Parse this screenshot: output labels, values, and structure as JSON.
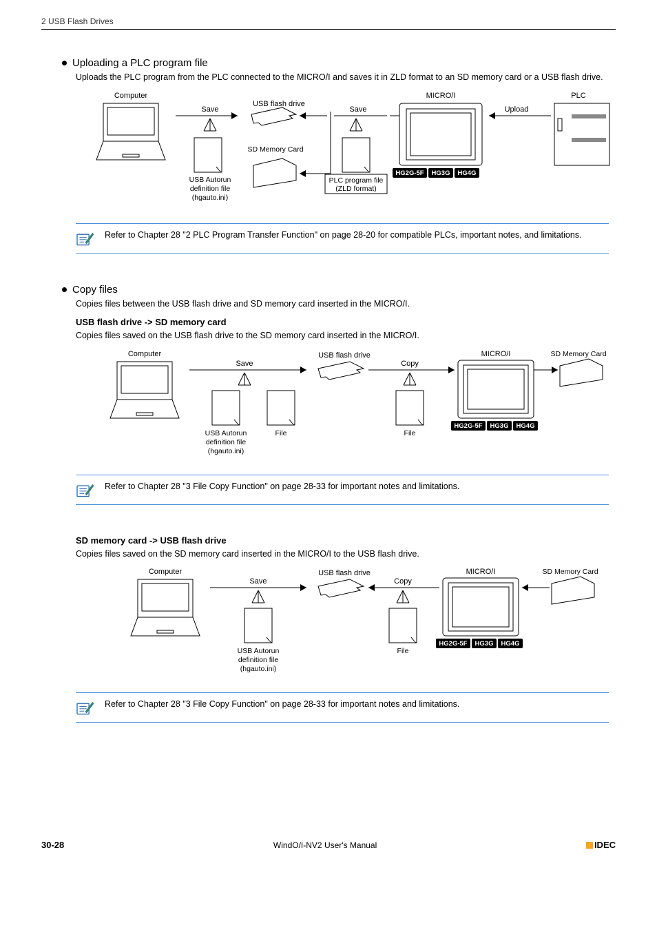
{
  "header": "2 USB Flash Drives",
  "sections": {
    "upload": {
      "title": "Uploading a PLC program file",
      "desc": "Uploads the PLC program from the PLC connected to the MICRO/I and saves it in ZLD format to an SD memory card or a USB flash drive.",
      "labels": {
        "computer": "Computer",
        "save": "Save",
        "usb": "USB flash drive",
        "sd": "SD Memory Card",
        "autorun1": "USB Autorun",
        "autorun2": "definition file",
        "autorun3": "(hgauto.ini)",
        "plcfile1": "PLC program file",
        "plcfile2": "(ZLD format)",
        "micro": "MICRO/I",
        "upload": "Upload",
        "plc": "PLC"
      },
      "badges": [
        "HG2G-5F",
        "HG3G",
        "HG4G"
      ],
      "note": "Refer to Chapter 28 \"2 PLC Program Transfer Function\" on page 28-20 for compatible PLCs, important notes, and limitations."
    },
    "copy": {
      "title": "Copy files",
      "desc": "Copies files between the USB flash drive and SD memory card inserted in the MICRO/I.",
      "sub1": {
        "bold": "USB flash drive -> SD memory card",
        "desc": "Copies files saved on the USB flash drive to the SD memory card inserted in the MICRO/I.",
        "labels": {
          "computer": "Computer",
          "save": "Save",
          "usb": "USB flash drive",
          "copy": "Copy",
          "micro": "MICRO/I",
          "sdcard": "SD Memory Card",
          "autorun1": "USB Autorun",
          "autorun2": "definition file",
          "autorun3": "(hgauto.ini)",
          "file": "File"
        },
        "badges": [
          "HG2G-5F",
          "HG3G",
          "HG4G"
        ],
        "note": "Refer to Chapter 28 \"3 File Copy Function\" on page 28-33 for important notes and limitations."
      },
      "sub2": {
        "bold": "SD memory card -> USB flash drive",
        "desc": "Copies files saved on the SD memory card inserted in the MICRO/I to the USB flash drive.",
        "labels": {
          "computer": "Computer",
          "save": "Save",
          "usb": "USB flash drive",
          "copy": "Copy",
          "micro": "MICRO/I",
          "sdcard": "SD Memory Card",
          "autorun1": "USB Autorun",
          "autorun2": "definition file",
          "autorun3": "(hgauto.ini)",
          "file": "File"
        },
        "badges": [
          "HG2G-5F",
          "HG3G",
          "HG4G"
        ],
        "note": "Refer to Chapter 28 \"3 File Copy Function\" on page 28-33 for important notes and limitations."
      }
    }
  },
  "footer": {
    "page": "30-28",
    "center": "WindO/I-NV2 User's Manual",
    "logo": "IDEC"
  }
}
